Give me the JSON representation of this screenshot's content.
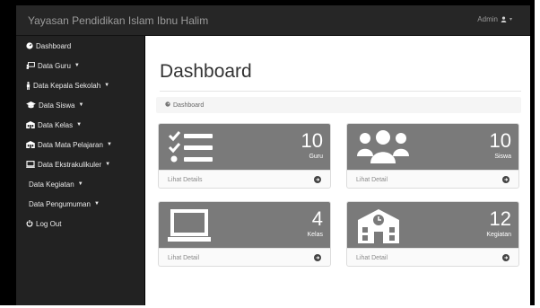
{
  "topbar": {
    "brand": "Yayasan Pendidikan Islam Ibnu Halim",
    "user_label": "Admin"
  },
  "sidebar": {
    "items": [
      {
        "label": "Dashboard",
        "icon": "dashboard-icon",
        "has_caret": false
      },
      {
        "label": "Data Guru",
        "icon": "teacher-icon",
        "has_caret": true
      },
      {
        "label": "Data Kepala Sekolah",
        "icon": "person-icon",
        "has_caret": true
      },
      {
        "label": "Data Siswa",
        "icon": "graduation-cap-icon",
        "has_caret": true
      },
      {
        "label": "Data Kelas",
        "icon": "building-icon",
        "has_caret": true
      },
      {
        "label": "Data Mata Pelajaran",
        "icon": "book-icon",
        "has_caret": true
      },
      {
        "label": "Data Ekstrakulikuler",
        "icon": "screen-icon",
        "has_caret": true
      },
      {
        "label": "Data Kegiatan",
        "icon": "",
        "has_caret": true
      },
      {
        "label": "Data Pengumuman",
        "icon": "",
        "has_caret": true
      },
      {
        "label": "Log Out",
        "icon": "power-icon",
        "has_caret": false
      }
    ]
  },
  "main": {
    "title": "Dashboard",
    "breadcrumb": "Dashboard"
  },
  "cards": [
    {
      "count": "10",
      "label": "Guru",
      "link": "Lihat Details",
      "icon": "checklist-icon"
    },
    {
      "count": "10",
      "label": "Siswa",
      "link": "Lihat Detail",
      "icon": "users-icon"
    },
    {
      "count": "4",
      "label": "Kelas",
      "link": "Lihat Detail",
      "icon": "laptop-icon"
    },
    {
      "count": "12",
      "label": "Kegiatan",
      "link": "Lihat Detail",
      "icon": "school-icon"
    }
  ],
  "colors": {
    "sidebar_bg": "#222222",
    "topbar_bg": "#262626",
    "card_head_bg": "#7a7a7a"
  }
}
